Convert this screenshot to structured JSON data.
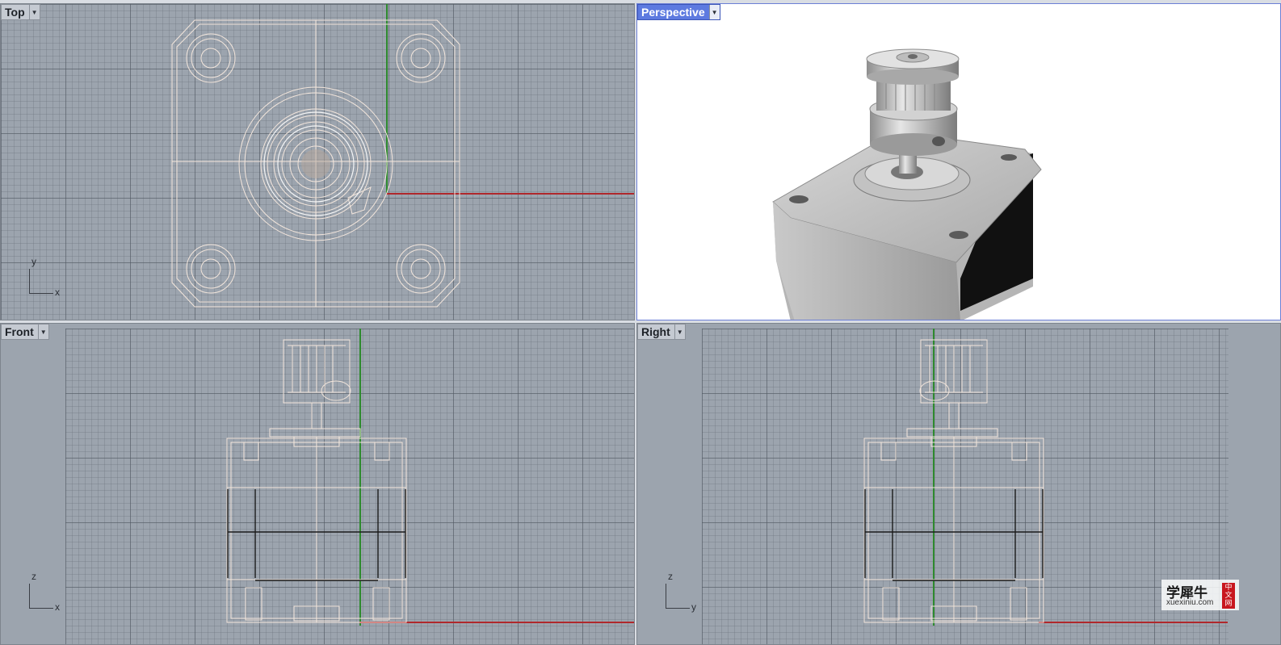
{
  "viewports": {
    "top": {
      "title": "Top",
      "axis_labels": {
        "vertical": "y",
        "horizontal": "x"
      }
    },
    "perspective": {
      "title": "Perspective",
      "active": true
    },
    "front": {
      "title": "Front",
      "axis_labels": {
        "vertical": "z",
        "horizontal": "x"
      }
    },
    "right": {
      "title": "Right",
      "axis_labels": {
        "vertical": "z",
        "horizontal": "y"
      }
    }
  },
  "colors": {
    "grid_background": "#9ca4ae",
    "x_axis": "#b0282c",
    "y_axis": "#2e8a2e",
    "wireframe": "#f3e6dc",
    "active_title": "#5d7ae0"
  },
  "icons": {
    "viewport_menu": "chevron-down-icon"
  },
  "watermark": {
    "text": "学犀牛",
    "url": "xuexiniu.com",
    "seal": "中文网"
  }
}
